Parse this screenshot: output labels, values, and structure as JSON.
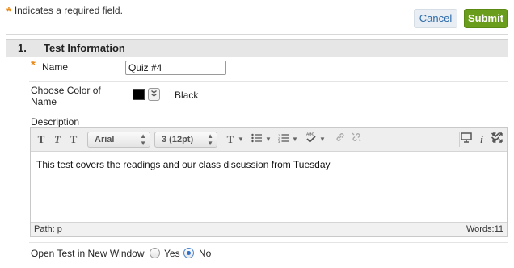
{
  "header": {
    "required_note": "Indicates a required field.",
    "cancel_label": "Cancel",
    "submit_label": "Submit"
  },
  "section": {
    "number": "1.",
    "title": "Test Information"
  },
  "name_field": {
    "label": "Name",
    "value": "Quiz #4"
  },
  "color_field": {
    "label": "Choose Color of Name",
    "color_name": "Black",
    "swatch_color": "#000000"
  },
  "description": {
    "label": "Description",
    "font_family": "Arial",
    "font_size": "3 (12pt)",
    "body_text": "This test covers the readings and our class discussion from Tuesday",
    "path": "Path: p",
    "words": "Words:11"
  },
  "open_window": {
    "label": "Open Test in New Window",
    "options": [
      "Yes",
      "No"
    ],
    "selected": "No"
  },
  "colors": {
    "submit": "#6b9d1d",
    "required_star": "#e88a17",
    "section_bg": "#e6e6e6"
  }
}
